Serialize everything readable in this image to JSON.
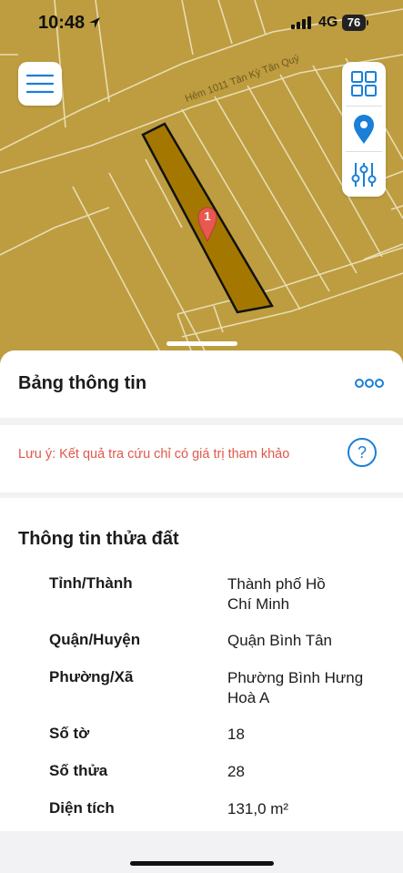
{
  "status_bar": {
    "time": "10:48",
    "network": "4G",
    "battery": "76"
  },
  "map": {
    "street_label": "Hẻm 1011 Tân Kỳ Tân Quý",
    "marker_label": "1",
    "parcel_color": "#a47800",
    "land_color": "#bd9d3f"
  },
  "sheet": {
    "title": "Bảng thông tin",
    "more_label": "ooo",
    "note": "Lưu ý: Kết quả tra cứu chỉ có giá trị tham khảo",
    "help_label": "?",
    "section_title": "Thông tin thửa đất",
    "rows": [
      {
        "label": "Tỉnh/Thành",
        "value": "Thành phố Hồ Chí Minh"
      },
      {
        "label": "Quận/Huyện",
        "value": "Quận Bình Tân"
      },
      {
        "label": "Phường/Xã",
        "value": "Phường Bình Hưng Hoà A"
      },
      {
        "label": "Số tờ",
        "value": "18"
      },
      {
        "label": "Số thửa",
        "value": "28"
      },
      {
        "label": "Diện tích",
        "value": "131,0 m²"
      }
    ]
  }
}
